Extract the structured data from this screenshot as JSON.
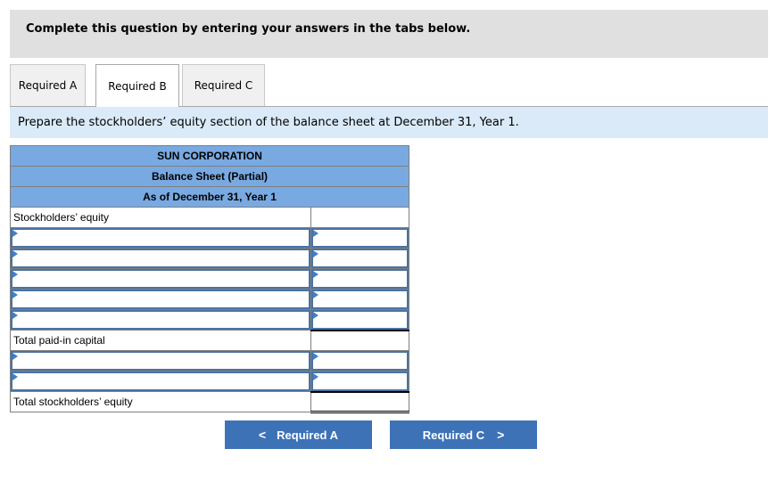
{
  "instructions": "Complete this question by entering your answers in the tabs below.",
  "tabs": [
    {
      "label": "Required A",
      "active": false
    },
    {
      "label": "Required B",
      "active": true
    },
    {
      "label": "Required C",
      "active": false
    }
  ],
  "prompt": "Prepare the stockholders’ equity section of the balance sheet at December 31, Year 1.",
  "balance_sheet": {
    "company": "SUN CORPORATION",
    "title": "Balance Sheet (Partial)",
    "date": "As of December 31, Year 1",
    "section_label": "Stockholders’ equity",
    "total_paid_in_label": "Total paid-in capital",
    "total_equity_label": "Total stockholders’ equity",
    "paid_in_rows": [
      {
        "account": "",
        "amount": ""
      },
      {
        "account": "",
        "amount": ""
      },
      {
        "account": "",
        "amount": ""
      },
      {
        "account": "",
        "amount": ""
      },
      {
        "account": "",
        "amount": ""
      }
    ],
    "other_rows": [
      {
        "account": "",
        "amount": ""
      },
      {
        "account": "",
        "amount": ""
      }
    ],
    "total_paid_in_value": "",
    "total_equity_value": ""
  },
  "nav": {
    "prev_label": "Required A",
    "next_label": "Required C",
    "prev_icon": "chevron-left-icon",
    "next_icon": "chevron-right-icon"
  },
  "colors": {
    "header_blue": "#79a9e1",
    "button_blue": "#3d72b7",
    "prompt_bg": "#daeaf8",
    "instr_bg": "#e0e0e0"
  }
}
